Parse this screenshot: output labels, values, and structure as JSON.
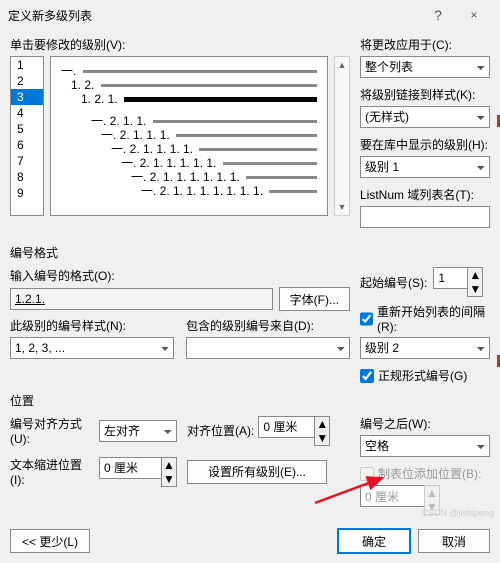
{
  "window": {
    "title": "定义新多级列表",
    "help": "?",
    "close": "×"
  },
  "levels": {
    "label": "单击要修改的级别(V):",
    "items": [
      "1",
      "2",
      "3",
      "4",
      "5",
      "6",
      "7",
      "8",
      "9"
    ],
    "selected": 2
  },
  "preview": {
    "lines": [
      {
        "indent": 0,
        "txt": "一. "
      },
      {
        "indent": 1,
        "txt": "1. 2. "
      },
      {
        "indent": 2,
        "txt": "1. 2. 1. ",
        "bold": true
      },
      {
        "indent": 3,
        "txt": "一. 2. 1. 1. "
      },
      {
        "indent": 4,
        "txt": "一. 2. 1. 1. 1. "
      },
      {
        "indent": 5,
        "txt": "一. 2. 1. 1. 1. 1. "
      },
      {
        "indent": 6,
        "txt": "一. 2. 1. 1. 1. 1. 1. "
      },
      {
        "indent": 7,
        "txt": "一. 2. 1. 1. 1. 1. 1. 1. "
      },
      {
        "indent": 8,
        "txt": "一. 2. 1. 1. 1. 1. 1. 1. 1. "
      }
    ]
  },
  "right": {
    "apply": {
      "label": "将更改应用于(C):",
      "value": "整个列表"
    },
    "link": {
      "label": "将级别链接到样式(K):",
      "value": "(无样式)"
    },
    "gallery": {
      "label": "要在库中显示的级别(H):",
      "value": "级别 1"
    },
    "listnum": {
      "label": "ListNum 域列表名(T):",
      "value": ""
    }
  },
  "fmt": {
    "title": "编号格式",
    "number_fmt": {
      "label": "输入编号的格式(O):",
      "value": "1.2.1."
    },
    "font_btn": "字体(F)...",
    "style": {
      "label": "此级别的编号样式(N):",
      "value": "1, 2, 3, ..."
    },
    "include": {
      "label": "包含的级别编号来自(D):",
      "value": ""
    },
    "start": {
      "label": "起始编号(S):",
      "value": "1"
    },
    "restart": {
      "label": "重新开始列表的间隔(R):",
      "checked": true,
      "value": "级别 2"
    },
    "legal": {
      "label": "正规形式编号(G)",
      "checked": true
    }
  },
  "pos": {
    "title": "位置",
    "align": {
      "label": "编号对齐方式(U):",
      "value": "左对齐"
    },
    "aligned_at": {
      "label": "对齐位置(A):",
      "value": "0 厘米"
    },
    "indent": {
      "label": "文本缩进位置(I):",
      "value": "0 厘米"
    },
    "set_all": "设置所有级别(E)...",
    "after": {
      "label": "编号之后(W):",
      "value": "空格"
    },
    "tab": {
      "label": "制表位添加位置(B):",
      "checked": false,
      "value": "0 厘米"
    }
  },
  "footer": {
    "more": "<< 更少(L)",
    "ok": "确定",
    "cancel": "取消"
  },
  "watermark": "CSDN @jishipeng"
}
